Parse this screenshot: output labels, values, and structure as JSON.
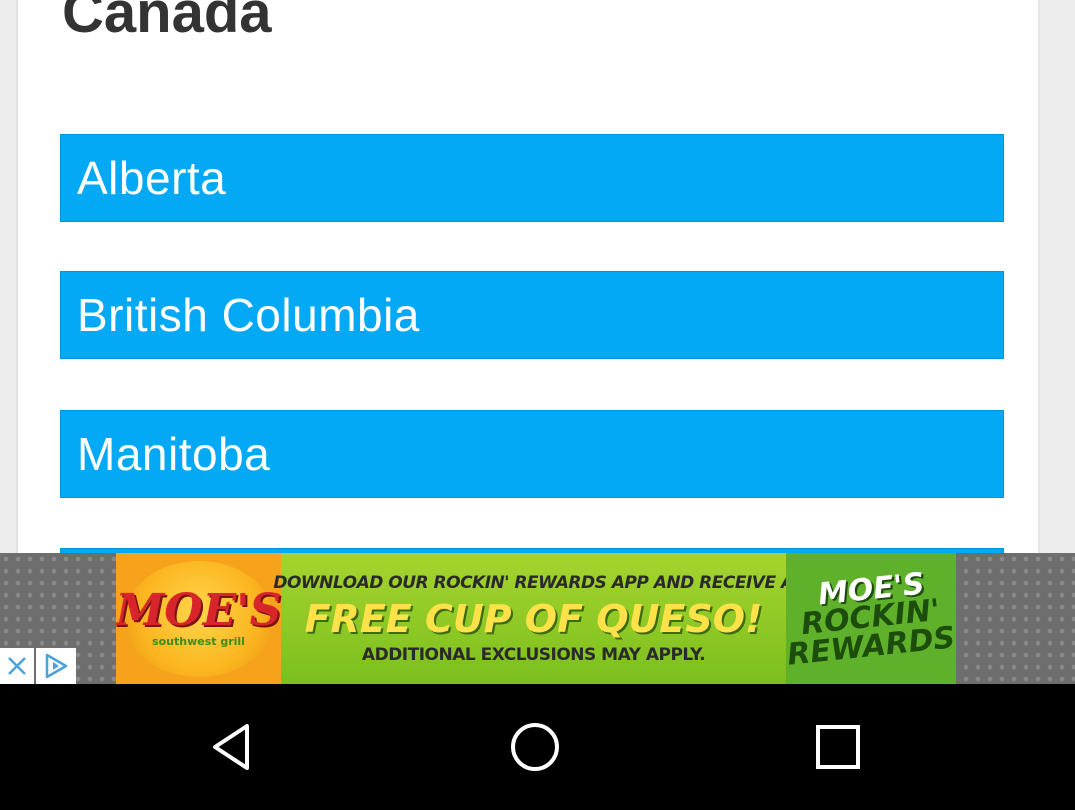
{
  "page": {
    "title": "Canada"
  },
  "regions": [
    {
      "label": "Alberta"
    },
    {
      "label": "British Columbia"
    },
    {
      "label": "Manitoba"
    }
  ],
  "ad": {
    "logo_text": "MOE'S",
    "logo_sub": "southwest grill",
    "line1": "DOWNLOAD OUR ROCKIN' REWARDS APP AND RECEIVE A",
    "line2": "FREE CUP OF QUESO!",
    "line3": "ADDITIONAL EXCLUSIONS MAY APPLY.",
    "badge_brand": "MOE'S",
    "badge_line1": "ROCKIN'",
    "badge_line2": "REWARDS",
    "close_icon": "close-icon",
    "choices_icon": "ad-choices-icon"
  },
  "navbar": {
    "back_icon": "back-triangle-icon",
    "home_icon": "home-circle-icon",
    "recents_icon": "recents-square-icon"
  },
  "colors": {
    "button_blue": "#03a9f4",
    "title_text": "#333333",
    "navbar": "#000000"
  }
}
